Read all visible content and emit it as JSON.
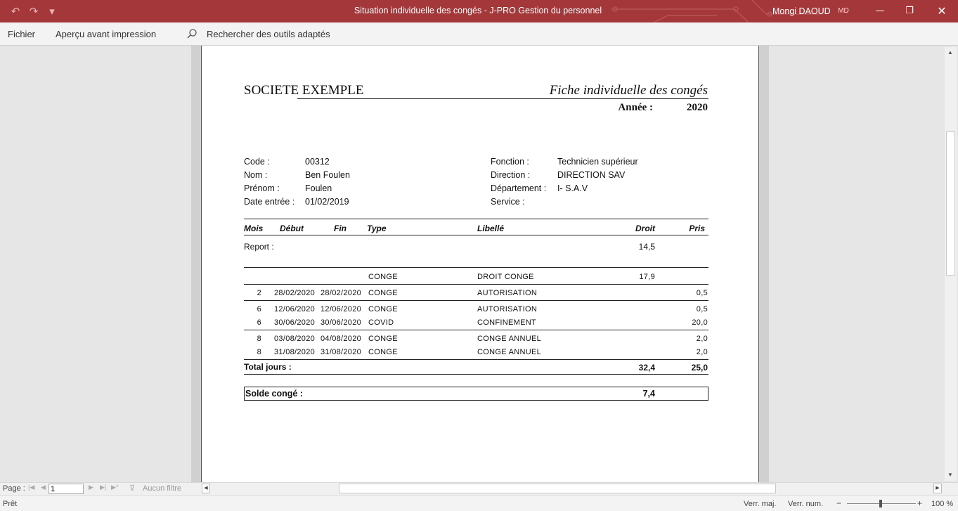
{
  "window": {
    "title": "Situation individuelle des congés  -  J-PRO Gestion du personnel",
    "user": "Mongi DAOUD",
    "user_initials": "MD",
    "accent_color": "#a4373a"
  },
  "ribbon": {
    "tabs": [
      "Fichier",
      "Aperçu avant impression"
    ],
    "search_placeholder": "Rechercher des outils adaptés"
  },
  "report": {
    "company": "SOCIETE EXEMPLE",
    "title": "Fiche individuelle des congés",
    "year_label": "Année :",
    "year": "2020",
    "employee": {
      "code_label": "Code  :",
      "code": "00312",
      "nom_label": "Nom :",
      "nom": "Ben Foulen",
      "prenom_label": "Prénom :",
      "prenom": "Foulen",
      "date_label": "Date entrée :",
      "date": "01/02/2019",
      "fonction_label": "Fonction :",
      "fonction": "Technicien supérieur",
      "direction_label": "Direction :",
      "direction": "DIRECTION SAV",
      "departement_label": "Département :",
      "departement": "I- S.A.V",
      "service_label": "Service :",
      "service": ""
    },
    "columns": {
      "mois": "Mois",
      "debut": "Début",
      "fin": "Fin",
      "type": "Type",
      "libelle": "Libellé",
      "droit": "Droit",
      "pris": "Pris"
    },
    "report_label": "Report :",
    "report_value": "14,5",
    "rows": [
      {
        "mois": "",
        "debut": "",
        "fin": "",
        "type": "CONGE",
        "libelle": "DROIT CONGE",
        "droit": "17,9",
        "pris": ""
      },
      {
        "mois": "2",
        "debut": "28/02/2020",
        "fin": "28/02/2020",
        "type": "CONGE",
        "libelle": "AUTORISATION",
        "droit": "",
        "pris": "0,5"
      },
      {
        "mois": "6",
        "debut": "12/06/2020",
        "fin": "12/06/2020",
        "type": "CONGE",
        "libelle": "AUTORISATION",
        "droit": "",
        "pris": "0,5"
      },
      {
        "mois": "6",
        "debut": "30/06/2020",
        "fin": "30/06/2020",
        "type": "COVID",
        "libelle": "CONFINEMENT",
        "droit": "",
        "pris": "20,0"
      },
      {
        "mois": "8",
        "debut": "03/08/2020",
        "fin": "04/08/2020",
        "type": "CONGE",
        "libelle": "CONGE ANNUEL",
        "droit": "",
        "pris": "2,0"
      },
      {
        "mois": "8",
        "debut": "31/08/2020",
        "fin": "31/08/2020",
        "type": "CONGE",
        "libelle": "CONGE ANNUEL",
        "droit": "",
        "pris": "2,0"
      }
    ],
    "total_label": "Total jours :",
    "total_droit": "32,4",
    "total_pris": "25,0",
    "solde_label": "Solde congé :",
    "solde_value": "7,4"
  },
  "navigation": {
    "page_label": "Page :",
    "page_value": "1",
    "filter_label": "Aucun filtre"
  },
  "statusbar": {
    "status": "Prêt",
    "verr_maj": "Verr. maj.",
    "verr_num": "Verr. num.",
    "zoom": "100 %",
    "zoom_level": 100
  }
}
